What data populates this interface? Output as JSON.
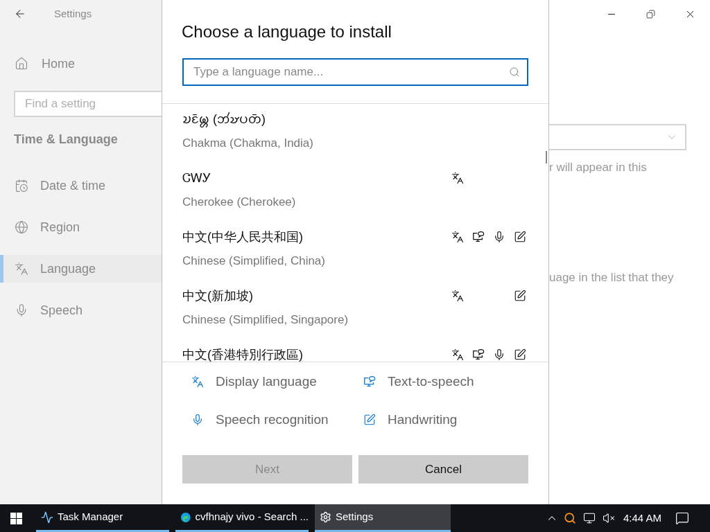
{
  "settings_window": {
    "title": "Settings",
    "home": "Home",
    "search": {
      "placeholder": "Find a setting"
    },
    "section": "Time & Language",
    "nav": [
      {
        "kind": "date",
        "label": "Date & time",
        "selected": false
      },
      {
        "kind": "region",
        "label": "Region",
        "selected": false
      },
      {
        "kind": "language",
        "label": "Language",
        "selected": true
      },
      {
        "kind": "speech",
        "label": "Speech",
        "selected": false
      }
    ],
    "content": {
      "line_1": "r will appear in this",
      "line_2": "uage in the list that they"
    }
  },
  "dialog": {
    "title": "Choose a language to install",
    "search": {
      "placeholder": "Type a language name..."
    },
    "languages": [
      {
        "native": "𑄌𑄋𑄴𑄟𑄳𑄦 (𑄃𑄧𑄏𑄛𑄖𑄴)",
        "english": "Chakma (Chakma, India)",
        "features": {
          "display": false,
          "tts": false,
          "speech": false,
          "handwriting": false
        }
      },
      {
        "native": "ᏣᎳᎩ",
        "english": "Cherokee (Cherokee)",
        "features": {
          "display": true,
          "tts": false,
          "speech": false,
          "handwriting": false
        }
      },
      {
        "native": "中文(中华人民共和国)",
        "english": "Chinese (Simplified, China)",
        "features": {
          "display": true,
          "tts": true,
          "speech": true,
          "handwriting": true
        }
      },
      {
        "native": "中文(新加坡)",
        "english": "Chinese (Simplified, Singapore)",
        "features": {
          "display": true,
          "tts": false,
          "speech": false,
          "handwriting": true
        }
      },
      {
        "native": "中文(香港特別行政區)",
        "features": {
          "display": true,
          "tts": true,
          "speech": true,
          "handwriting": true
        }
      }
    ],
    "legend": [
      {
        "kind": "display",
        "label": "Display language"
      },
      {
        "kind": "tts",
        "label": "Text-to-speech"
      },
      {
        "kind": "speech",
        "label": "Speech recognition"
      },
      {
        "kind": "handwriting",
        "label": "Handwriting"
      }
    ],
    "buttons": [
      {
        "label": "Next",
        "disabled": true
      },
      {
        "label": "Cancel",
        "disabled": false
      }
    ]
  },
  "taskbar": {
    "apps": [
      {
        "kind": "task_manager",
        "label": "Task Manager",
        "selected": false
      },
      {
        "kind": "browser",
        "label": "cvfhnajy vivo - Search ...",
        "selected": false
      },
      {
        "kind": "settings",
        "label": "Settings",
        "selected": true
      }
    ],
    "clock": "4:44 AM"
  }
}
